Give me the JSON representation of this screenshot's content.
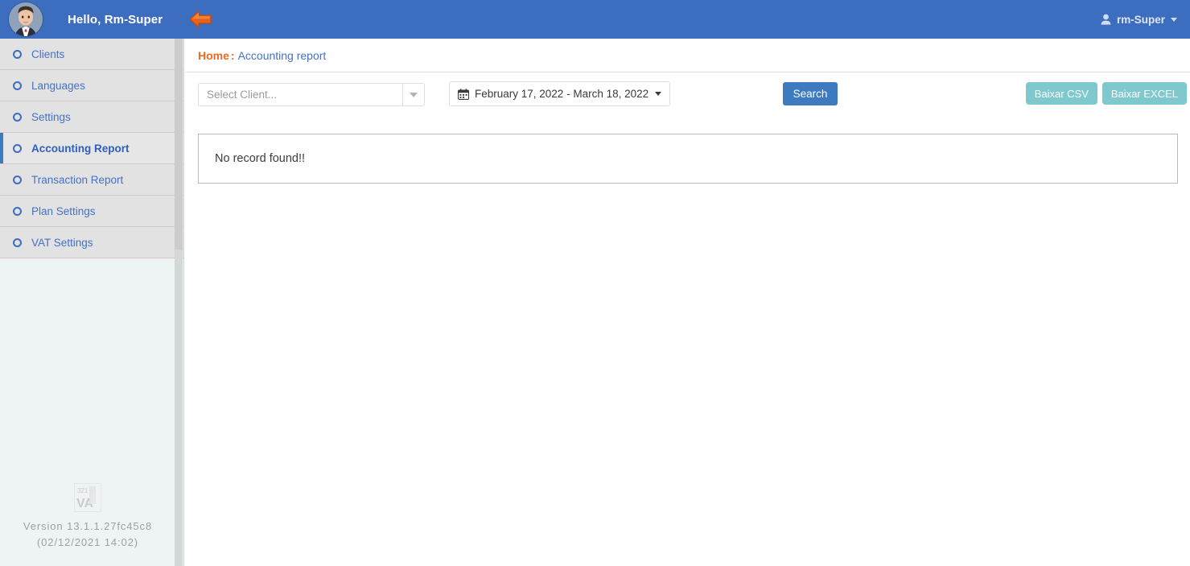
{
  "header": {
    "greeting": "Hello, Rm-Super",
    "back_arrow_icon": "arrow-left-icon",
    "avatar_icon": "user-avatar",
    "user_name": "rm-Super",
    "user_icon": "user-icon",
    "caret_icon": "chevron-down-icon",
    "bg_color": "#3c6dbf"
  },
  "sidebar": {
    "items": [
      {
        "label": "Clients",
        "active": false
      },
      {
        "label": "Languages",
        "active": false
      },
      {
        "label": "Settings",
        "active": false
      },
      {
        "label": "Accounting Report",
        "active": true
      },
      {
        "label": "Transaction Report",
        "active": false
      },
      {
        "label": "Plan Settings",
        "active": false
      },
      {
        "label": "VAT Settings",
        "active": false
      }
    ],
    "bullet_icon": "circle-outline-icon",
    "footer": {
      "logo_icon": "brand-321va-logo",
      "logo_top_text": "321",
      "logo_bottom_text": "VA",
      "version": "Version 13.1.1.27fc45c8",
      "build_date": "(02/12/2021 14:02)"
    },
    "accent_color": "#3d7bc0",
    "menu_bg": "#e2e2e2",
    "panel_bg": "#eef4f3"
  },
  "breadcrumb": {
    "home": "Home",
    "separator": ":",
    "current": "Accounting report",
    "home_color": "#ed6a24",
    "current_color": "#4572c4"
  },
  "filters": {
    "client_select": {
      "placeholder": "Select Client...",
      "value": "",
      "caret_icon": "chevron-down-icon"
    },
    "date_range": {
      "value": "February 17, 2022 - March 18, 2022",
      "calendar_icon": "calendar-icon",
      "caret_icon": "chevron-down-icon"
    },
    "search_button": {
      "label": "Search",
      "color": "#3d7ac0"
    },
    "exports": [
      {
        "label": "Baixar CSV",
        "name": "download-csv-button"
      },
      {
        "label": "Baixar EXCEL",
        "name": "download-excel-button"
      }
    ],
    "export_color": "#7fc9ce"
  },
  "results": {
    "empty_message": "No record found!!"
  }
}
